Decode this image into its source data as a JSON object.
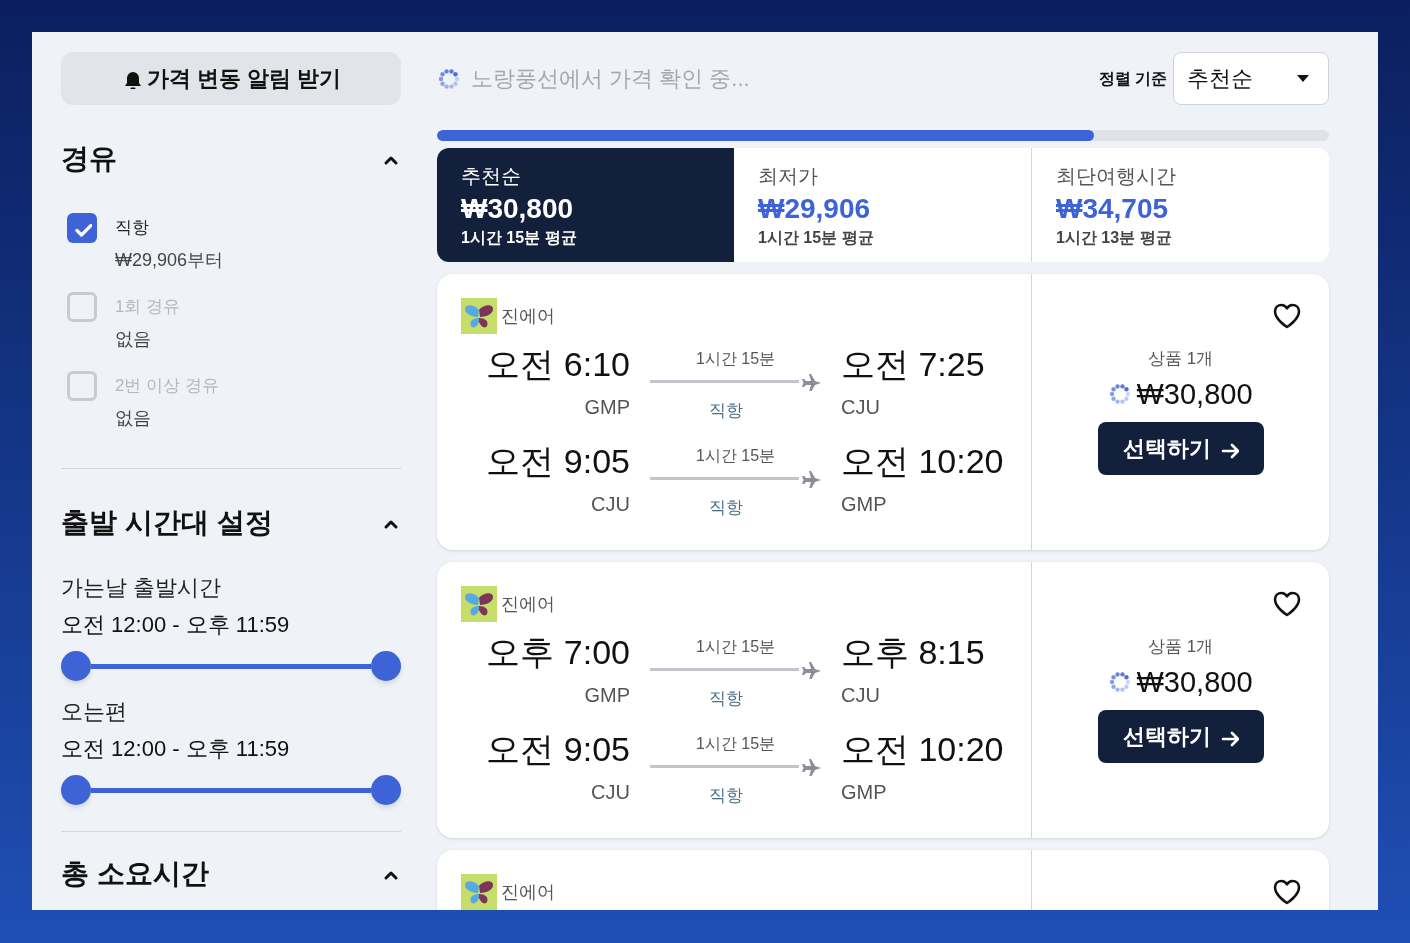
{
  "alert_button": {
    "label": "가격 변동 알림 받기"
  },
  "sidebar": {
    "sections": [
      {
        "title": "경유",
        "expanded": true,
        "kind": "checkboxes",
        "options": [
          {
            "label": "직항",
            "sub": "₩29,906부터",
            "checked": true,
            "disabled": false
          },
          {
            "label": "1회 경유",
            "sub": "없음",
            "checked": false,
            "disabled": true
          },
          {
            "label": "2번 이상 경유",
            "sub": "없음",
            "checked": false,
            "disabled": true
          }
        ]
      },
      {
        "title": "출발 시간대 설정",
        "expanded": true,
        "kind": "sliders",
        "sliders": [
          {
            "label": "가는날 출발시간",
            "range": "오전 12:00 - 오후 11:59",
            "level": 1
          },
          {
            "label": "오는편",
            "range": "오전 12:00 - 오후 11:59",
            "level": 1
          }
        ]
      },
      {
        "title": "총 소요시간",
        "expanded": true,
        "kind": "collapsed_view"
      }
    ]
  },
  "status": {
    "text": "노랑풍선에서 가격 확인 중..."
  },
  "sort": {
    "label": "정렬 기준",
    "value": "추천순"
  },
  "progress": {
    "level": 0.737
  },
  "tabs": [
    {
      "label": "추천순",
      "price": "₩30,800",
      "duration": "1시간 15분 평균",
      "selected": true
    },
    {
      "label": "최저가",
      "price": "₩29,906",
      "duration": "1시간 15분 평균",
      "selected": false
    },
    {
      "label": "최단여행시간",
      "price": "₩34,705",
      "duration": "1시간 13분 평균",
      "selected": false
    }
  ],
  "results": [
    {
      "airline": "진에어",
      "favorited": false,
      "legs": [
        {
          "depart_time": "오전 6:10",
          "depart_airport": "GMP",
          "duration": "1시간 15분",
          "stops": "직항",
          "arrive_time": "오전 7:25",
          "arrive_airport": "CJU"
        },
        {
          "depart_time": "오전 9:05",
          "depart_airport": "CJU",
          "duration": "1시간 15분",
          "stops": "직항",
          "arrive_time": "오전 10:20",
          "arrive_airport": "GMP"
        }
      ],
      "offers": "상품 1개",
      "price": "₩30,800",
      "button": "선택하기"
    },
    {
      "airline": "진에어",
      "favorited": false,
      "legs": [
        {
          "depart_time": "오후 7:00",
          "depart_airport": "GMP",
          "duration": "1시간 15분",
          "stops": "직항",
          "arrive_time": "오후 8:15",
          "arrive_airport": "CJU"
        },
        {
          "depart_time": "오전 9:05",
          "depart_airport": "CJU",
          "duration": "1시간 15분",
          "stops": "직항",
          "arrive_time": "오전 10:20",
          "arrive_airport": "GMP"
        }
      ],
      "offers": "상품 1개",
      "price": "₩30,800",
      "button": "선택하기"
    },
    {
      "airline": "진에어",
      "favorited": false
    }
  ]
}
